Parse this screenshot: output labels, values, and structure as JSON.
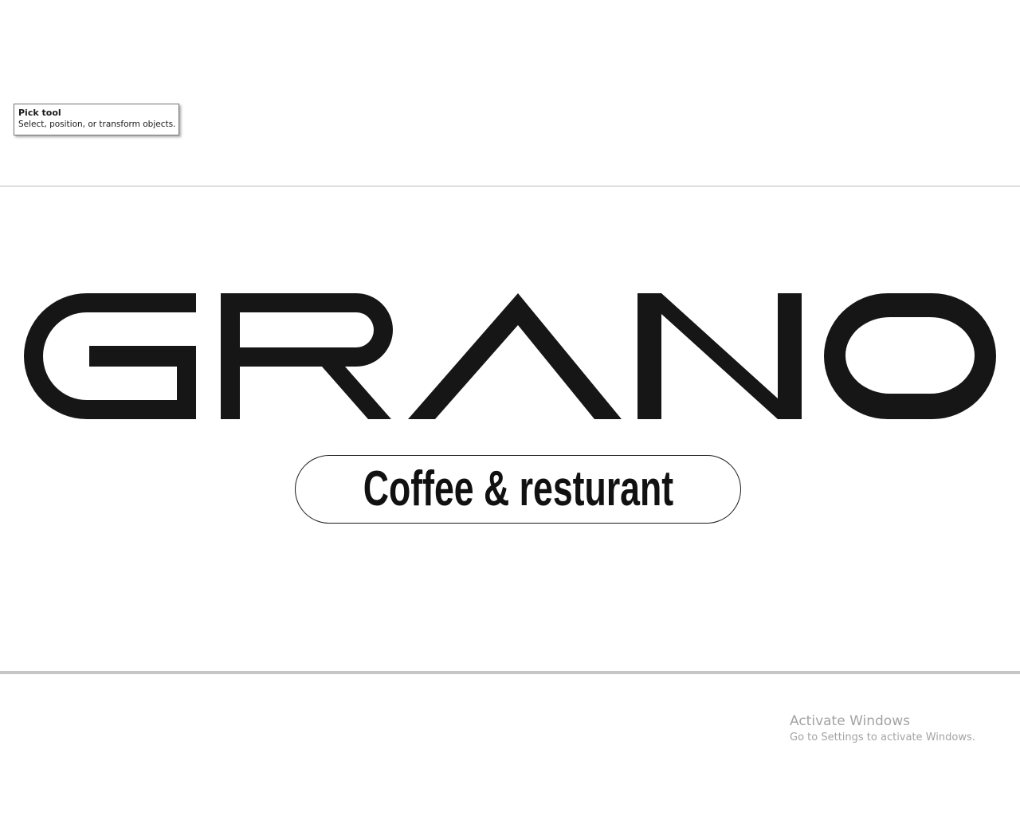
{
  "tooltip": {
    "title": "Pick tool",
    "description": "Select, position, or transform objects."
  },
  "logo": {
    "wordmark": "GRANO",
    "tagline": "Coffee & resturant",
    "color": "#161616"
  },
  "watermark": {
    "title": "Activate Windows",
    "subtitle": "Go to Settings to activate Windows."
  }
}
